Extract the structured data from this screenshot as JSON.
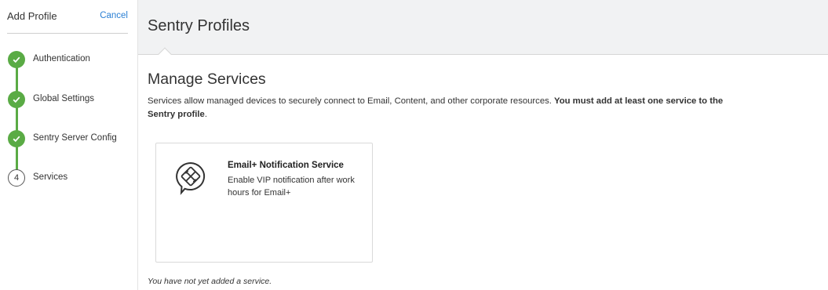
{
  "sidebar": {
    "title": "Add Profile",
    "cancel_label": "Cancel",
    "steps": [
      {
        "label": "Authentication",
        "status": "complete"
      },
      {
        "label": "Global Settings",
        "status": "complete"
      },
      {
        "label": "Sentry Server Config",
        "status": "complete"
      },
      {
        "label": "Services",
        "status": "current",
        "number": "4"
      }
    ]
  },
  "header": {
    "title": "Sentry Profiles"
  },
  "main": {
    "section_title": "Manage Services",
    "description_plain": "Services allow managed devices to securely connect to Email, Content, and other corporate resources. ",
    "description_bold_1": "You must add at least one service to the",
    "description_bold_2": "Sentry profile",
    "description_end": ".",
    "services": [
      {
        "title": "Email+ Notification Service",
        "description": "Enable VIP notification after work hours for Email+",
        "icon": "exchange-chat-icon"
      }
    ],
    "empty_note": "You have not yet added a service."
  },
  "colors": {
    "step_complete": "#5aab45",
    "link": "#2a7fd4",
    "header_bg": "#f1f2f3"
  }
}
